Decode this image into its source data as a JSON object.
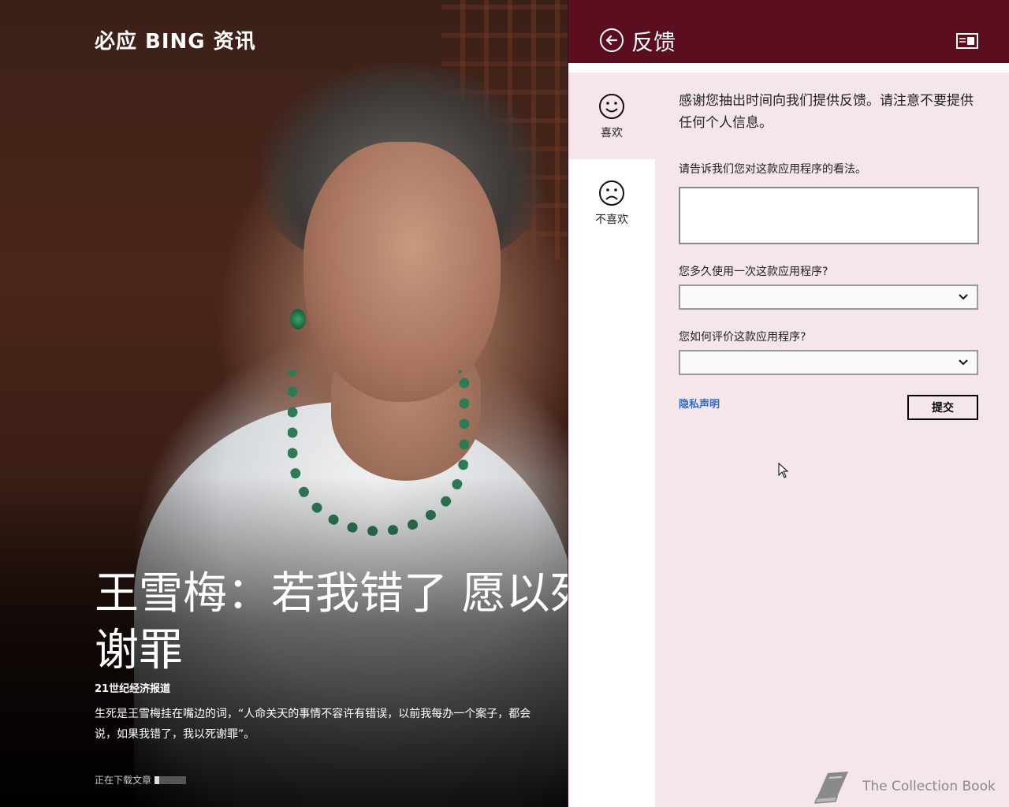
{
  "app": {
    "title": "必应 BING 资讯"
  },
  "article": {
    "headline": "王雪梅：若我错了 愿以死谢罪",
    "source": "21世纪经济报道",
    "summary_line1": "生死是王雪梅挂在嘴边的词，“人命关天的事情不容许有错误，以前我每办一个案子，都会",
    "summary_line2": "说，如果我错了，我以死谢罪”。",
    "download_status": "正在下载文章",
    "download_progress": 0.15
  },
  "feedback": {
    "title": "反馈",
    "ratings": [
      {
        "label": "喜欢",
        "icon": "smile-icon",
        "selected": true
      },
      {
        "label": "不喜欢",
        "icon": "frown-icon",
        "selected": false
      }
    ],
    "intro": "感谢您抽出时间向我们提供反馈。请注意不要提供任何个人信息。",
    "opinion_label": "请告诉我们您对这款应用程序的看法。",
    "opinion_value": "",
    "frequency_label": "您多久使用一次这款应用程序?",
    "frequency_value": "",
    "rate_label": "您如何评价这款应用程序?",
    "rate_value": "",
    "privacy_link": "隐私声明",
    "submit_label": "提交"
  },
  "watermark": {
    "text": "The Collection Book"
  },
  "colors": {
    "header": "#5a0e20",
    "panel_bg": "#f5e6ea",
    "link": "#2a6fc9"
  }
}
